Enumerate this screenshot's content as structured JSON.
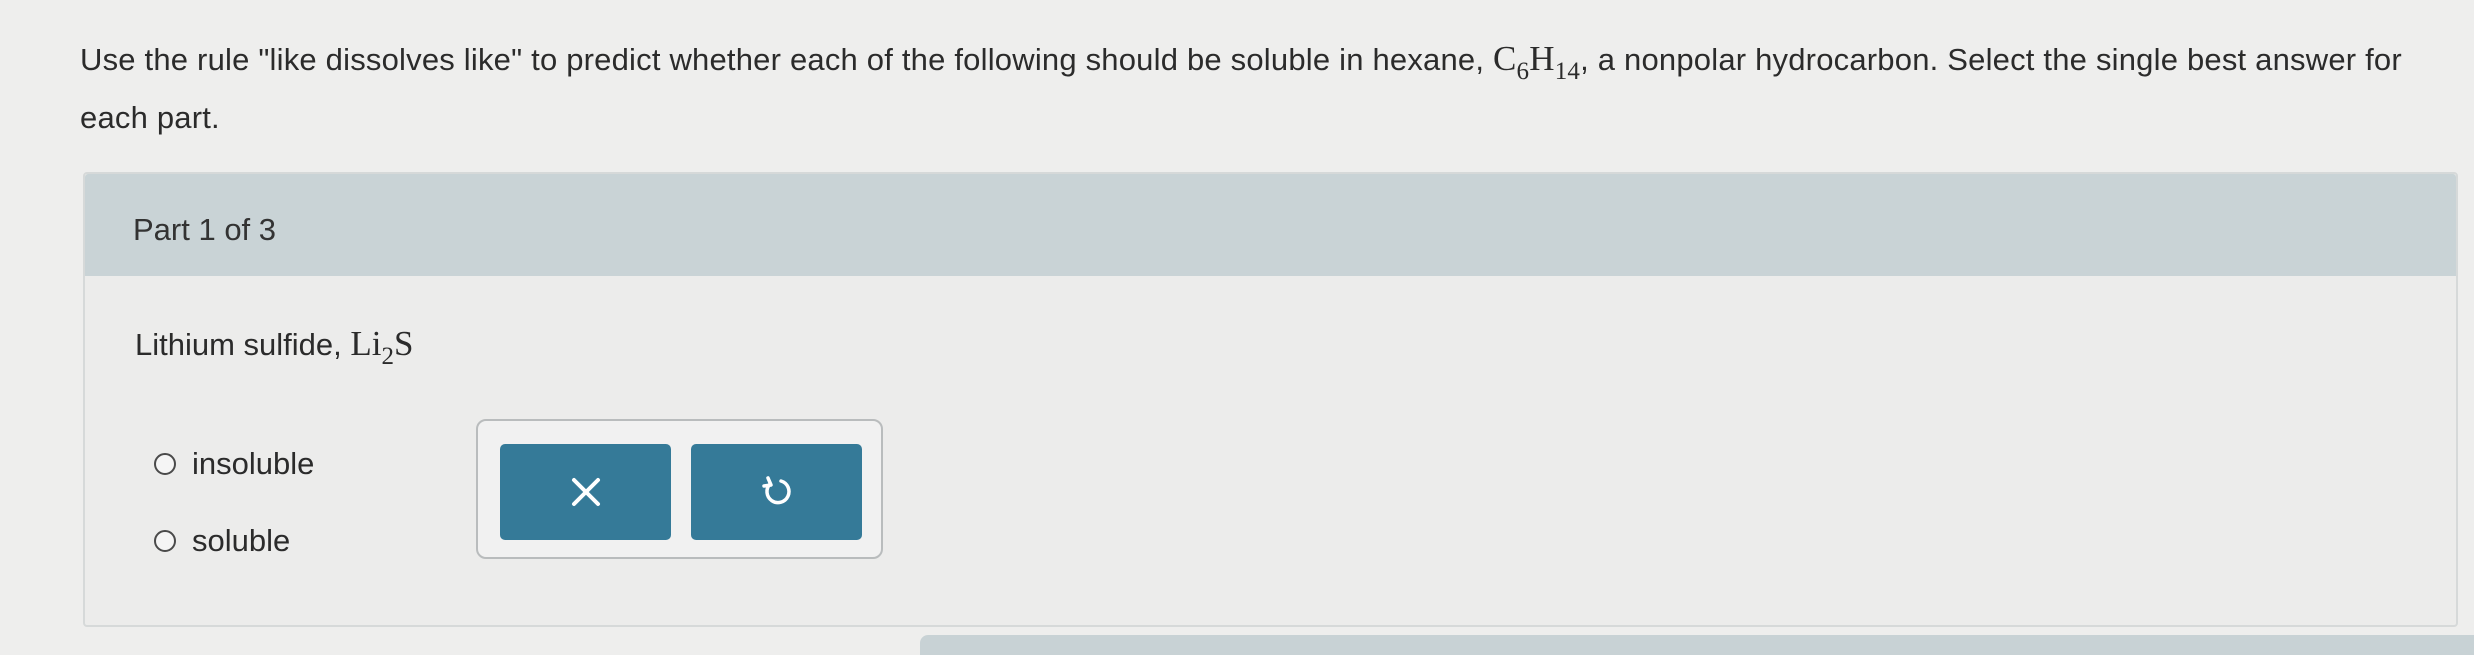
{
  "question": {
    "intro": "Use the rule \"like dissolves like\" to predict whether each of the following should be soluble in hexane,",
    "formula_base_1": "C",
    "formula_sub_1": "6",
    "formula_base_2": "H",
    "formula_sub_2": "14",
    "formula_trailing": ",",
    "rest": " a nonpolar hydrocarbon. Select the single best answer for each part."
  },
  "part": {
    "label": "Part 1 of 3",
    "prompt_text": "Lithium sulfide, ",
    "compound_base_1": "Li",
    "compound_sub_1": "2",
    "compound_base_2": "S",
    "options": [
      {
        "label": "insoluble",
        "selected": false
      },
      {
        "label": "soluble",
        "selected": false
      }
    ]
  },
  "actions": {
    "clear_icon": "x-icon",
    "undo_icon": "undo-icon",
    "button_color": "#357a98"
  }
}
